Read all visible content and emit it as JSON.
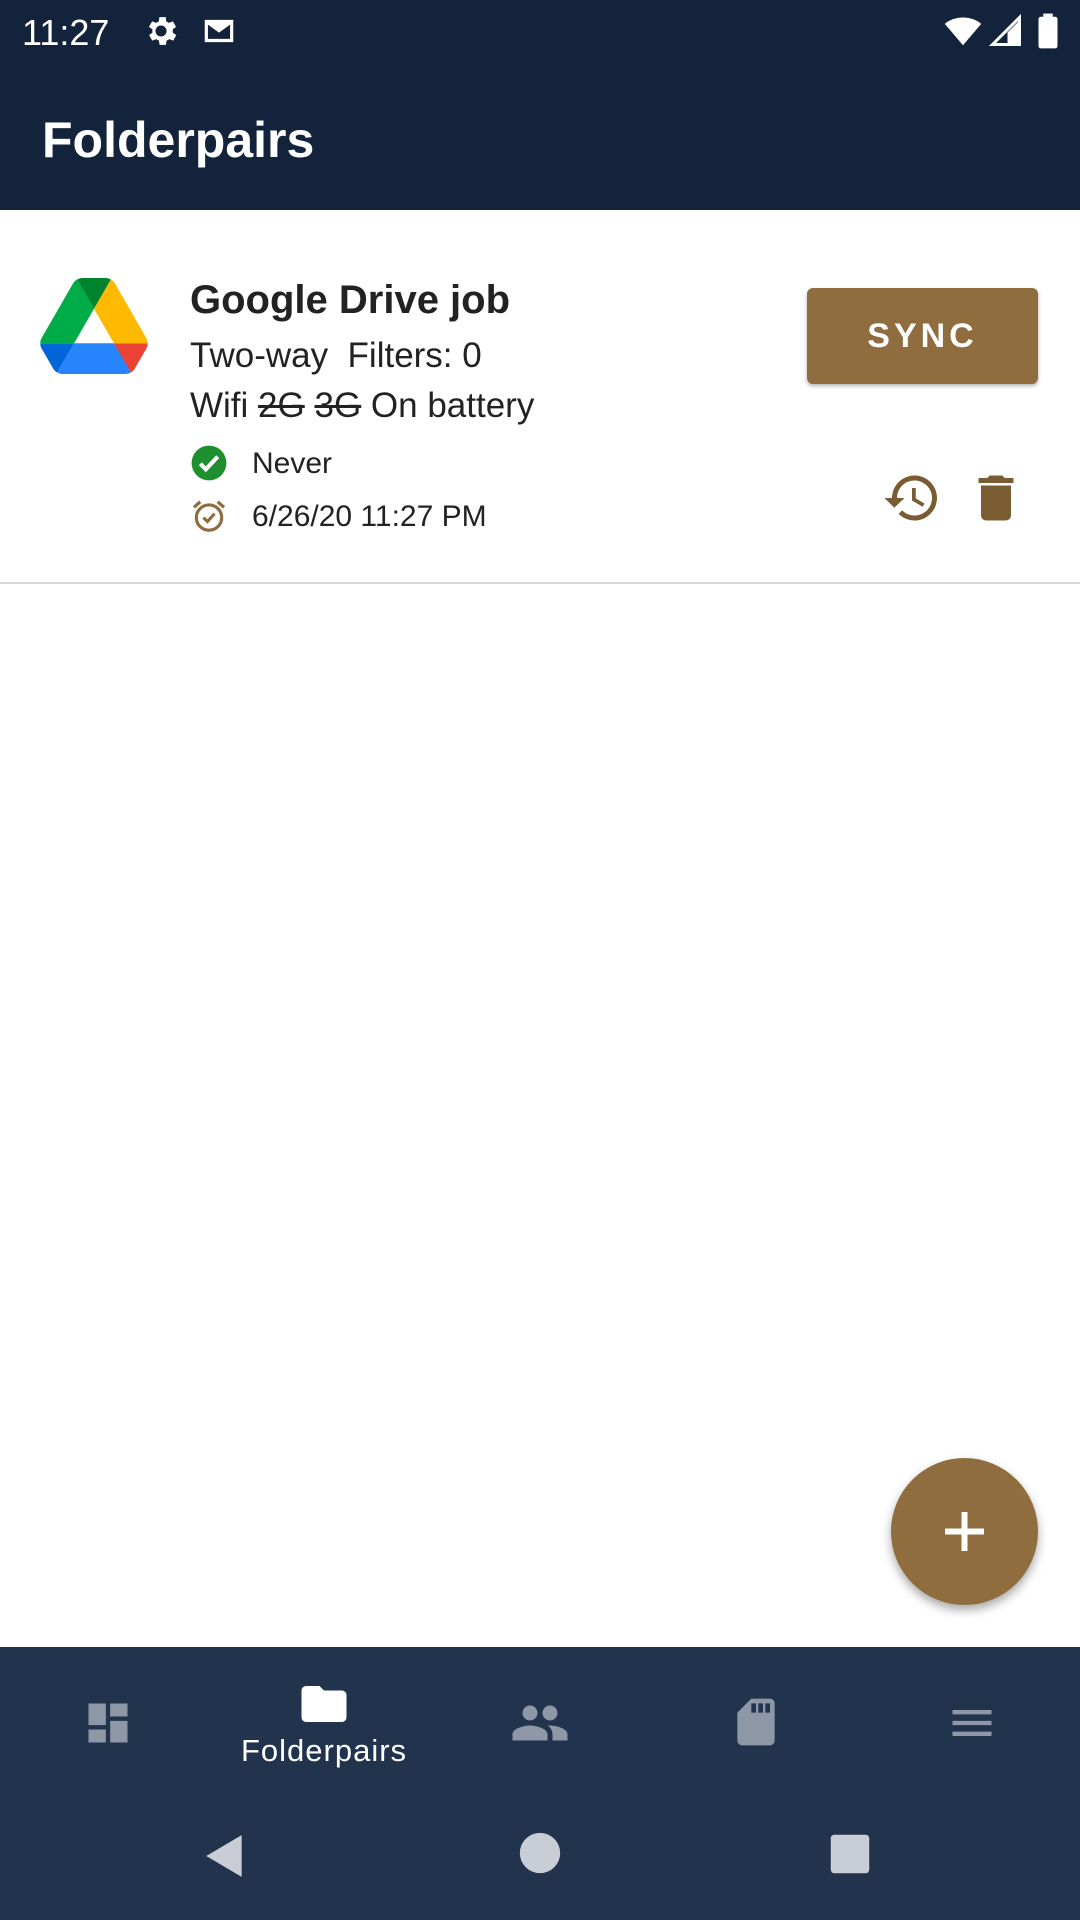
{
  "status_bar": {
    "time": "11:27",
    "icons": [
      "settings-gear-icon",
      "gmail-icon",
      "wifi-icon",
      "cell-signal-icon",
      "battery-icon"
    ]
  },
  "app_bar": {
    "title": "Folderpairs"
  },
  "job": {
    "title": "Google Drive job",
    "line1": "Two-way  Filters: 0",
    "wifi": "Wifi",
    "net_2g": "2G",
    "net_3g": "3G",
    "battery": "On battery",
    "last_sync": "Never",
    "next_sync": "6/26/20 11:27 PM",
    "sync_label": "SYNC"
  },
  "bottom_nav": {
    "items": [
      {
        "icon": "dashboard-icon",
        "label": ""
      },
      {
        "icon": "folder-icon",
        "label": "Folderpairs"
      },
      {
        "icon": "accounts-icon",
        "label": ""
      },
      {
        "icon": "sd-card-icon",
        "label": ""
      },
      {
        "icon": "menu-icon",
        "label": ""
      }
    ]
  },
  "colors": {
    "app_bar": "#13233b",
    "nav_bar": "#21334d",
    "accent": "#8f6d3f",
    "success": "#1e8f2f"
  }
}
